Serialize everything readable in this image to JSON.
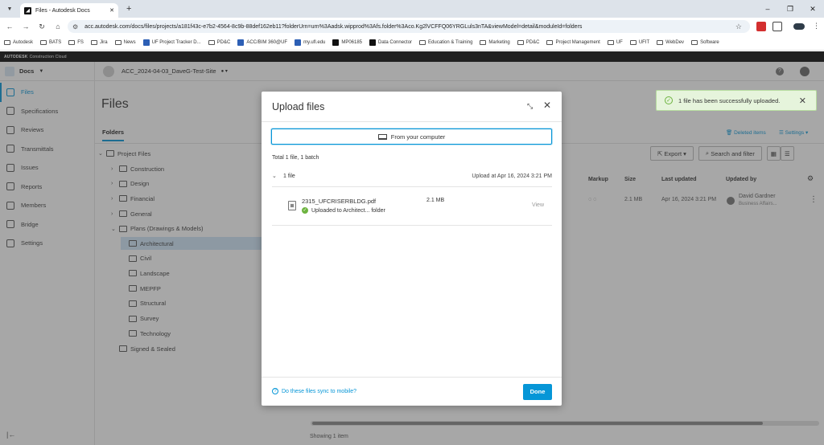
{
  "browser": {
    "tab_title": "Files - Autodesk Docs",
    "url": "acc.autodesk.com/docs/files/projects/a181f43c-e7b2-4564-8c9b-88def162eb11?folderUrn=urn%3Aadsk.wipprod%3Afs.folder%3Aco.Kg2lVCFFQ06YRGLuls3nTA&viewModel=detail&moduleId=folders",
    "bookmarks": [
      "Autodesk",
      "BATS",
      "FS",
      "Jira",
      "News",
      "UF Project Tracker D...",
      "PD&C",
      "ACC/BIM 360@UF",
      "my.ufl.edu",
      "MP06185",
      "Data Connector",
      "Education & Training",
      "Marketing",
      "PD&C",
      "Project Management",
      "UF",
      "UFIT",
      "WebDev",
      "Software"
    ]
  },
  "brand": {
    "bold": "AUTODESK",
    "rest": "Construction Cloud"
  },
  "app": {
    "module": "Docs",
    "project": "ACC_2024-04-03_DaveG-Test-Site",
    "sidebar": [
      {
        "label": "Files",
        "icon": "file-icon"
      },
      {
        "label": "Specifications",
        "icon": "specifications-icon"
      },
      {
        "label": "Reviews",
        "icon": "reviews-icon"
      },
      {
        "label": "Transmittals",
        "icon": "transmittals-icon"
      },
      {
        "label": "Issues",
        "icon": "issues-icon"
      },
      {
        "label": "Reports",
        "icon": "reports-icon"
      },
      {
        "label": "Members",
        "icon": "members-icon"
      },
      {
        "label": "Bridge",
        "icon": "bridge-icon"
      },
      {
        "label": "Settings",
        "icon": "gear-icon"
      }
    ],
    "page_title": "Files",
    "folders_tab": "Folders",
    "tree": {
      "root": "Project Files",
      "level1": [
        "Construction",
        "Design",
        "Financial",
        "General",
        "Plans (Drawings & Models)"
      ],
      "plans_children": [
        "Architectural",
        "Civil",
        "Landscape",
        "MEPFP",
        "Structural",
        "Survey",
        "Technology"
      ],
      "signed": "Signed & Sealed"
    },
    "toolbar": {
      "deleted_items": "Deleted items",
      "settings": "Settings",
      "export": "Export",
      "search": "Search and filter"
    },
    "table": {
      "headers": [
        "Markup",
        "Size",
        "Last updated",
        "Updated by"
      ],
      "row": {
        "size": "2.1 MB",
        "last_updated": "Apr 16, 2024 3:21 PM",
        "updated_by": "David Gardner",
        "updated_by_sub": "Business Affairs..."
      }
    },
    "showing": "Showing 1 item"
  },
  "toast": {
    "message": "1 file has been successfully uploaded."
  },
  "modal": {
    "title": "Upload files",
    "from_computer": "From your computer",
    "total": "Total 1 file, 1 batch",
    "batch_label": "1 file",
    "batch_time": "Upload at Apr 16, 2024 3:21 PM",
    "file": {
      "name": "2315_UFCRISERBLDG.pdf",
      "size": "2.1 MB",
      "status": "Uploaded to Architect... folder",
      "view": "View"
    },
    "sync_link": "Do these files sync to mobile?",
    "done": "Done"
  },
  "colors": {
    "accent": "#0696d7",
    "success": "#6db33f",
    "selected_row": "#cfe6f7"
  }
}
